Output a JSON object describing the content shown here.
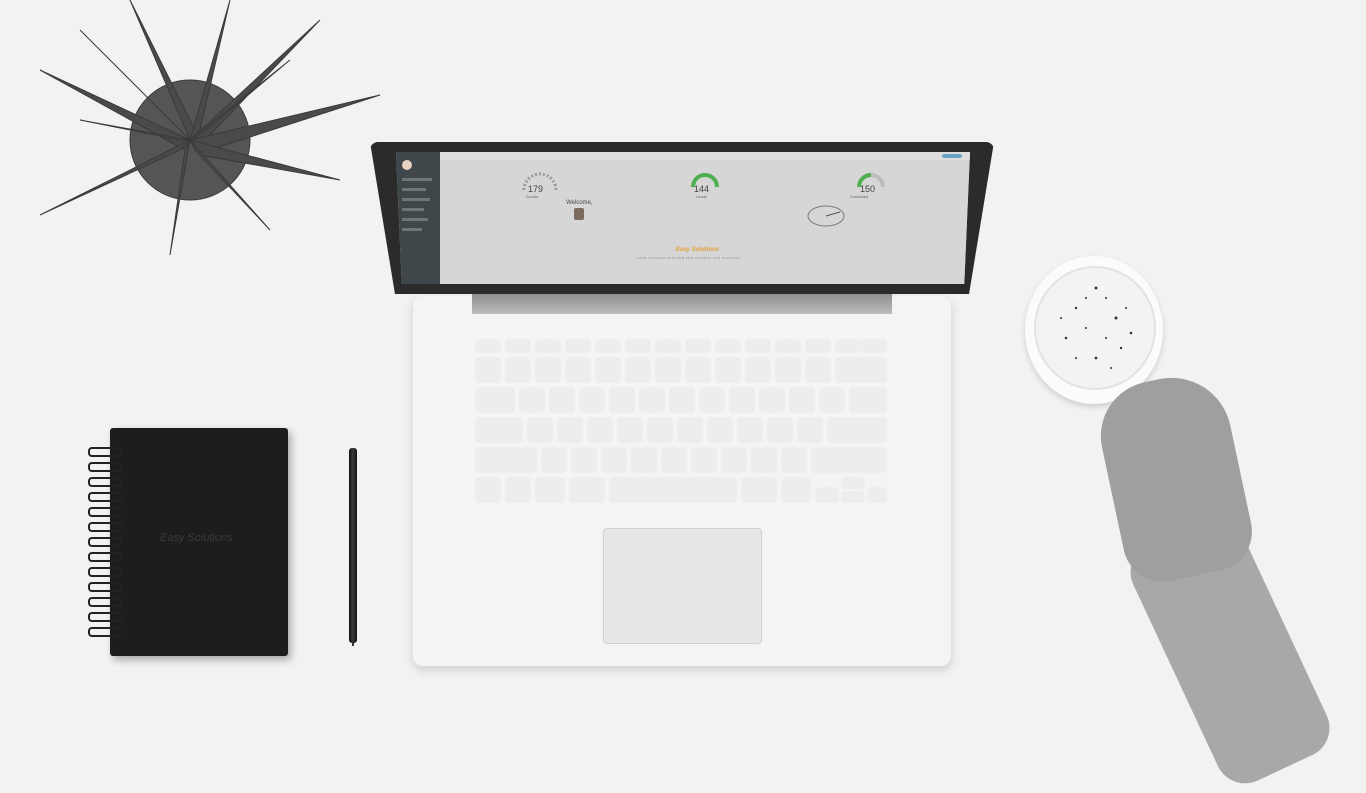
{
  "screen": {
    "sidebar_items": [
      "",
      "",
      "",
      "",
      "",
      "",
      ""
    ],
    "stat_1": {
      "value": "179",
      "label": "Scouts"
    },
    "stat_2": {
      "value": "144",
      "label": "Leads"
    },
    "stat_3": {
      "value": "150",
      "label": "Contacted"
    },
    "welcome_text": "Welcome,",
    "brand_text": "Easy Solutions",
    "tagline_text": "YOUR TRUSTED PARTNER FOR GROWTH AND SUCCESS"
  },
  "notebook": {
    "logo_text": "Easy Solutions"
  },
  "colors": {
    "background": "#f2f2f2",
    "laptop_base": "#f4f4f4",
    "sidebar": "#3f474a",
    "accent_green": "#4caf50",
    "logo_orange": "#e0a03a"
  },
  "icons": [
    "plant",
    "laptop",
    "notebook",
    "pen",
    "coffee-cup",
    "hand"
  ]
}
